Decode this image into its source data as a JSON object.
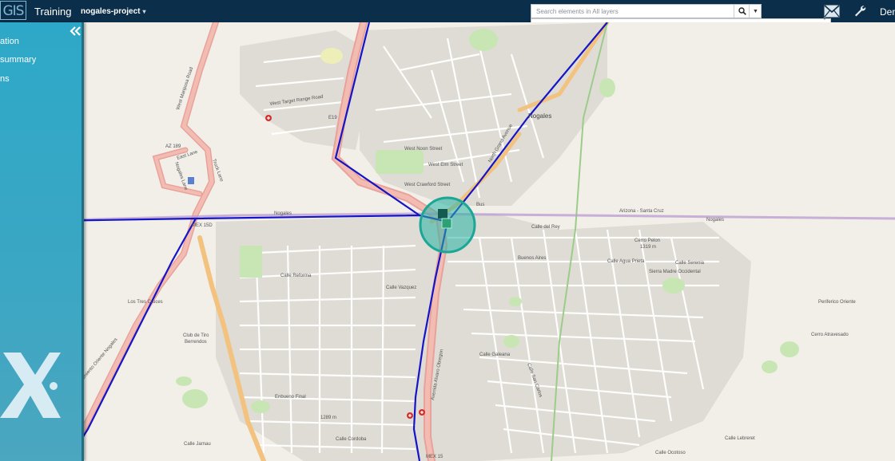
{
  "header": {
    "logo_text": "GIS",
    "app_title": "Training",
    "project_name": "nogales-project",
    "user_label": "Dem"
  },
  "search": {
    "placeholder": "Search elements in All layers",
    "search_icon": "magnifier-icon",
    "dropdown_icon": "caret-down-icon"
  },
  "toolbar": {
    "mail_icon": "envelope-icon",
    "tools_icon": "wrench-icon"
  },
  "sidebar": {
    "collapse_icon": "double-chevron-left-icon",
    "items": [
      {
        "label": "ation"
      },
      {
        "label": "summary"
      },
      {
        "label": "ns"
      }
    ],
    "brand_mark": "X."
  },
  "map": {
    "base": "OpenStreetMap",
    "labels": {
      "west_target_range_road": "West Target Range Road",
      "west_mariposa_road": "West Mariposa Road",
      "nogales": "Nogales",
      "e19": "E19",
      "az189": "AZ 189",
      "east_lane": "East Lane",
      "truck_lane": "Truck Lane",
      "nogales_lane": "Nogales Lane",
      "west_noon_street": "West Noon Street",
      "west_elm_street": "West Elm Street",
      "west_crawford_street": "West Crawford Street",
      "arizona_santa_cruz": "Arizona - Santa Cruz",
      "nogales_border": "Nogales",
      "nogales_border_east": "Nogales",
      "mex15d": "MEX 15D",
      "mex15": "MEX 15",
      "los_tres_cruces": "Los Tres Cruces",
      "club_de_tiro": "Club de Tiro",
      "berrendos": "Berrendos",
      "cerro_pelon": "Cerro Pelon",
      "cerro_pelon_elev": "1319 m",
      "cerro_atravesado": "Cerro Atravesado",
      "calle_reforma": "Calle Reforma",
      "calle_vazquez": "Calle Vazquez",
      "calle_serenia": "Calle Serenia",
      "sierra_madre_occidental": "Sierra Madre Occidental",
      "periferico_oriente": "Periferico Oriente",
      "calle_agua_prieta": "Calle Agua Prieta",
      "buenos_aires": "Buenos Aires",
      "calle_del_rey": "Calle del Rey",
      "calle_ocotoso": "Calle Ocotoso",
      "calle_lebreret": "Calle Lebreret",
      "embueno_final": "Enbueno Final",
      "elev_1289": "1289 m",
      "calle_cordoba": "Calle Cordoba",
      "calle_jarnau": "Calle Jarnau",
      "libramiento": "Libramiento Oriente Nogales",
      "north_grand": "North Grand Avenue",
      "bus": "Bus",
      "calle_san_carlos": "Calle San Carlos",
      "calle_galeana": "Calle Galeana",
      "avenida_obregon": "Avenida Alvaro Obregon"
    }
  },
  "colors": {
    "header_bg": "#0b2f4a",
    "sidebar_bg": "#2ea8c8",
    "map_bg": "#f2efe9",
    "route_line": "#1515c8",
    "selection_circle": "#20b2a0"
  }
}
